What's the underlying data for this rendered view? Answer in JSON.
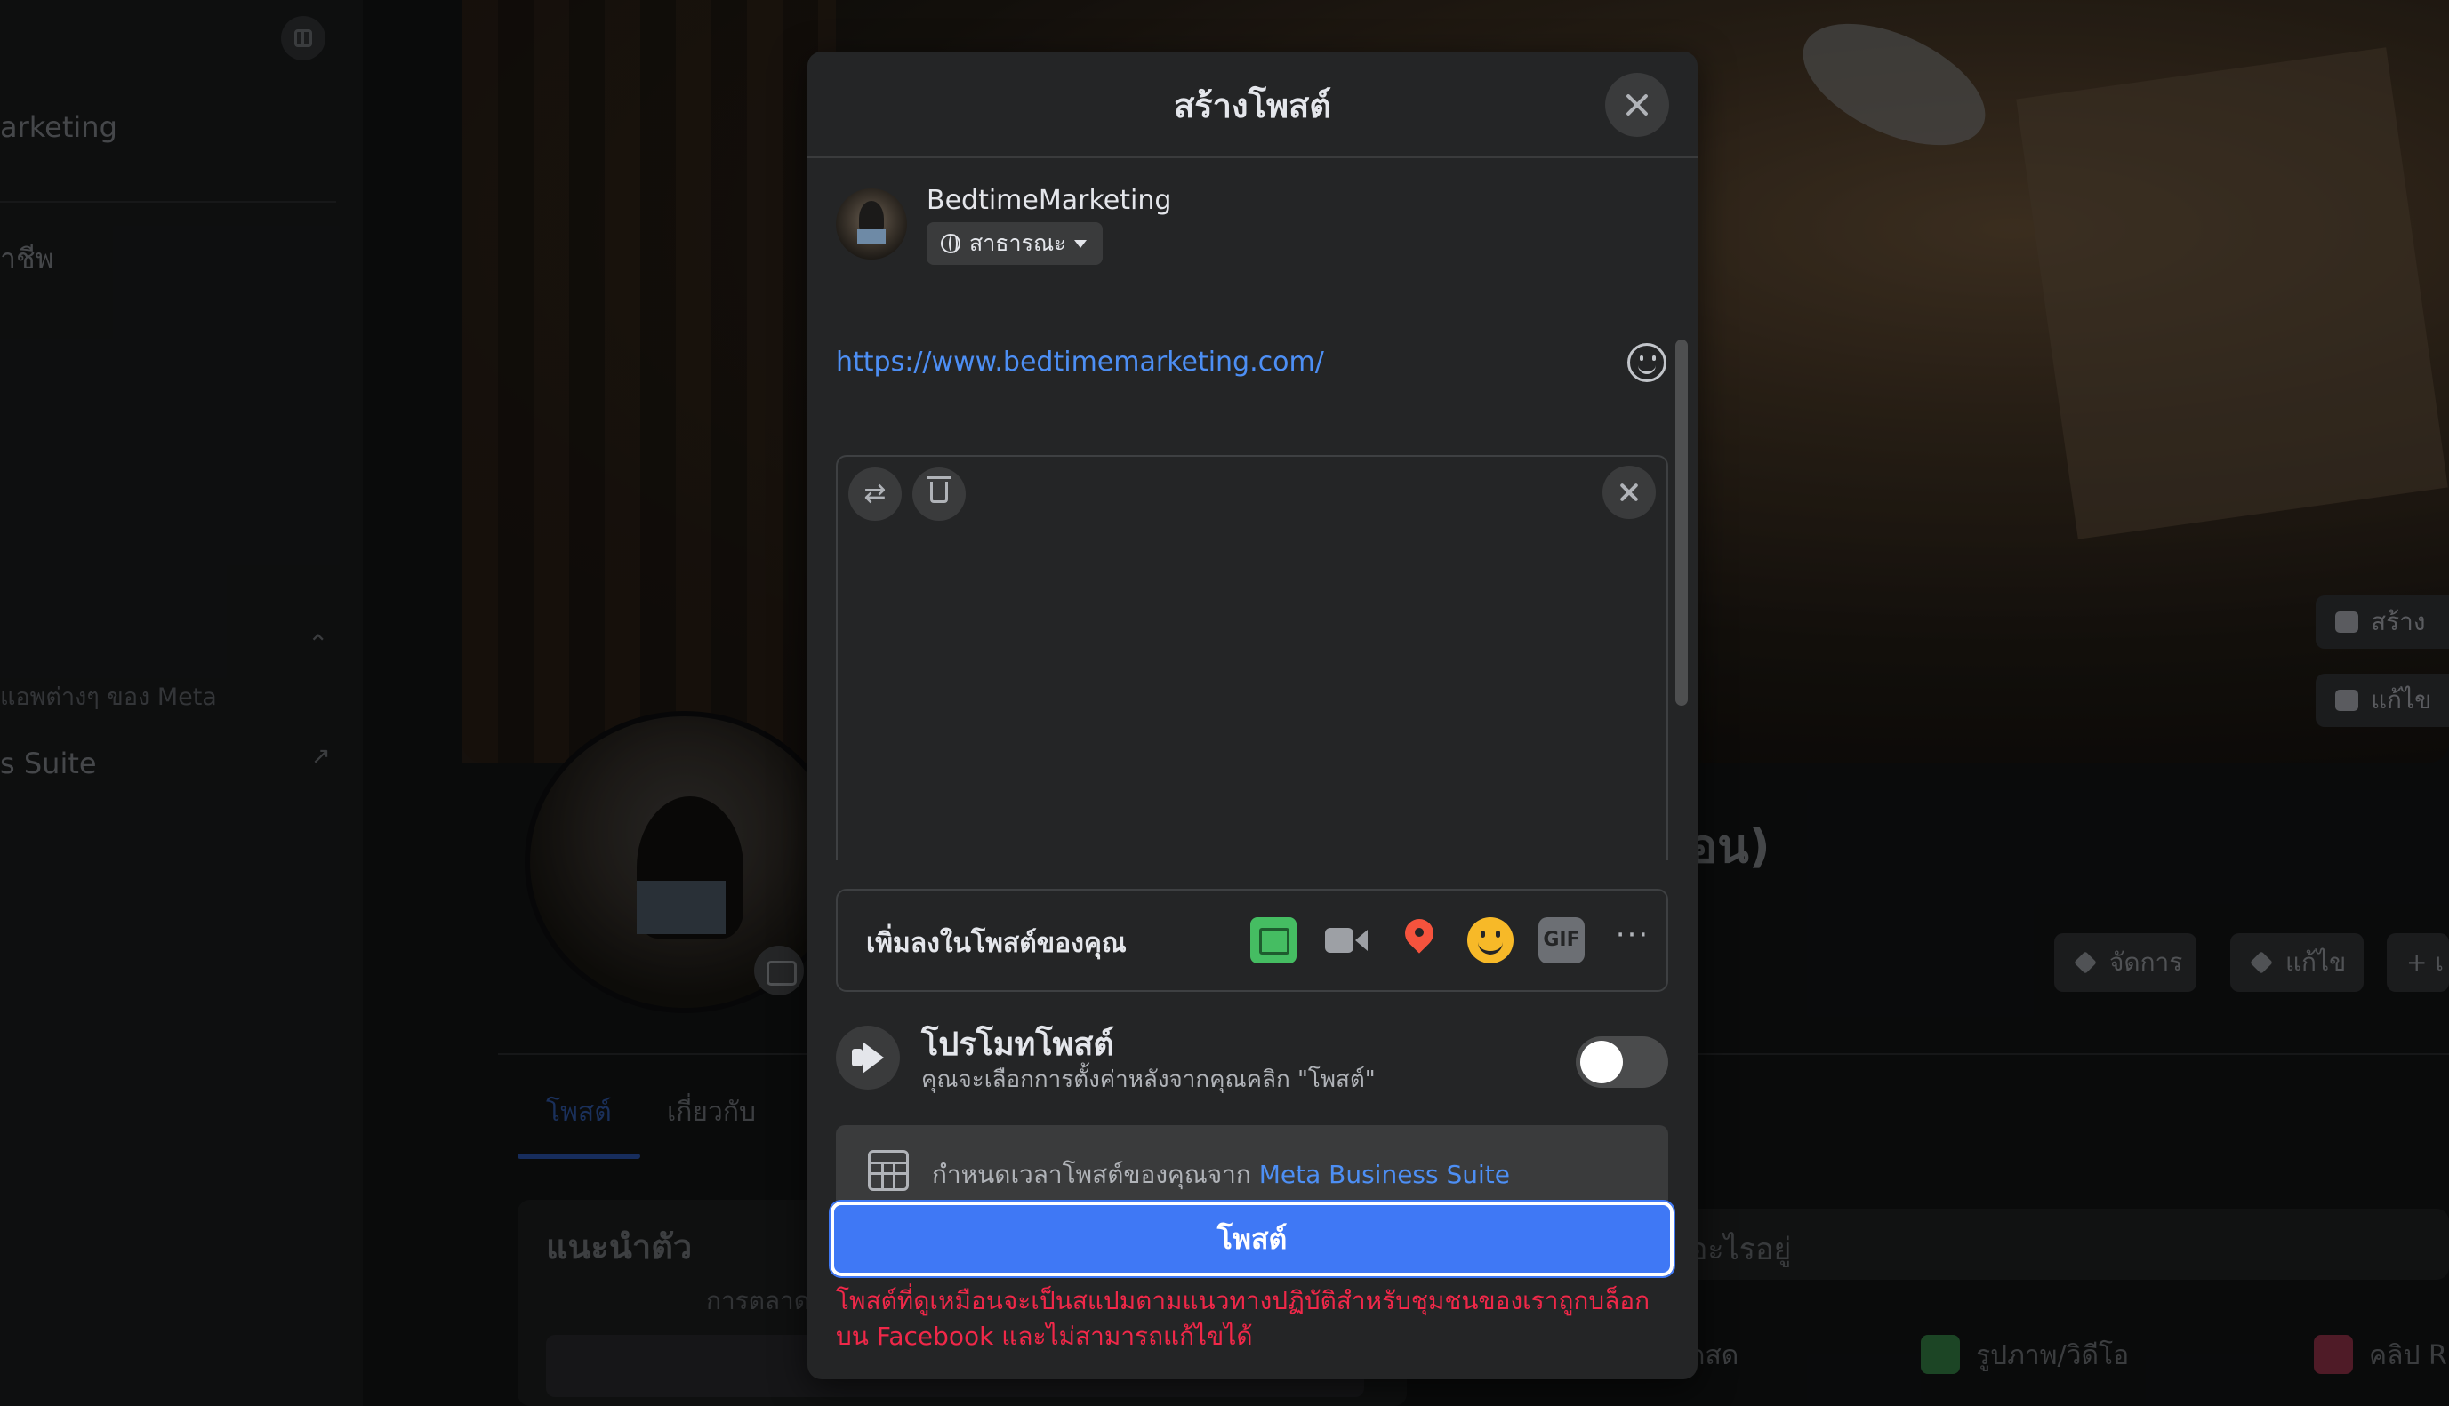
{
  "background": {
    "sidebar": {
      "items": [
        {
          "label": "arketing"
        },
        {
          "label": "าชีพ"
        },
        {
          "label": "แอพต่างๆ ของ Meta"
        },
        {
          "label": "s Suite"
        }
      ]
    },
    "cover_buttons": [
      {
        "label": "สร้าง"
      },
      {
        "label": "แก้ไข"
      }
    ],
    "page_name_partial": "อน)",
    "page_actions": [
      {
        "label": "จัดการ"
      },
      {
        "label": "แก้ไข"
      },
      {
        "label": "+ เ"
      }
    ],
    "tabs": [
      {
        "label": "โพสต์"
      },
      {
        "label": "เกี่ยวกับ"
      }
    ],
    "intro_card": {
      "title": "แนะนำตัว",
      "subtitle": "การตลาด"
    },
    "composer": {
      "placeholder": "อะไรอยู่",
      "actions": [
        {
          "label": "อดสด"
        },
        {
          "label": "รูปภาพ/วิดีโอ"
        },
        {
          "label": "คลิป R"
        }
      ]
    }
  },
  "modal": {
    "title": "สร้างโพสต์",
    "author": {
      "name": "BedtimeMarketing",
      "audience": "สาธารณะ"
    },
    "post_text": "https://www.bedtimemarketing.com/",
    "add_to_post": {
      "label": "เพิ่มลงในโพสต์ของคุณ",
      "icons": [
        "photo-video-icon",
        "video-camera-icon",
        "location-icon",
        "feeling-icon",
        "gif-icon",
        "more-icon"
      ],
      "gif_text": "GIF",
      "more_text": "···"
    },
    "promote": {
      "title": "โปรโมทโพสต์",
      "subtitle": "คุณจะเลือกการตั้งค่าหลังจากคุณคลิก \"โพสต์\"",
      "enabled": false
    },
    "schedule": {
      "text": "กำหนดเวลาโพสต์ของคุณจาก ",
      "link": "Meta Business Suite"
    },
    "post_button": "โพสต์",
    "error": "โพสต์ที่ดูเหมือนจะเป็นสแปมตามแนวทางปฏิบัติสำหรับชุมชนของเราถูกบล็อก บน Facebook และไม่สามารถแก้ไขได้"
  },
  "colors": {
    "accent": "#3f78f5",
    "link": "#4d8ff5",
    "error": "#f02849",
    "modal_bg": "#242526"
  }
}
